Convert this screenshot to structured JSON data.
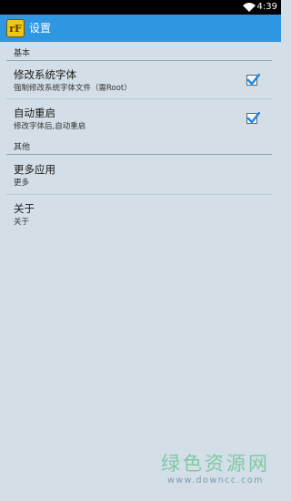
{
  "status_bar": {
    "time": "4:39",
    "icons": [
      "wifi-icon"
    ]
  },
  "action_bar": {
    "icon": "app-icon",
    "icon_text": "rF",
    "title": "设置"
  },
  "sections": [
    {
      "header": "基本",
      "items": [
        {
          "title": "修改系统字体",
          "subtitle": "强制修改系统字体文件（需Root）",
          "checked": true
        },
        {
          "title": "自动重启",
          "subtitle": "修改字体后,自动重启",
          "checked": true
        }
      ]
    },
    {
      "header": "其他",
      "items": [
        {
          "title": "更多应用",
          "subtitle": "更多"
        },
        {
          "title": "关于",
          "subtitle": "关于"
        }
      ]
    }
  ],
  "watermark": {
    "main": "绿色资源网",
    "url": "www.downcc.com"
  },
  "colors": {
    "action_bar": "#2f96e2",
    "background": "#d3dee6",
    "checkmark": "#1e88e5",
    "watermark": "#7fc9a5"
  }
}
